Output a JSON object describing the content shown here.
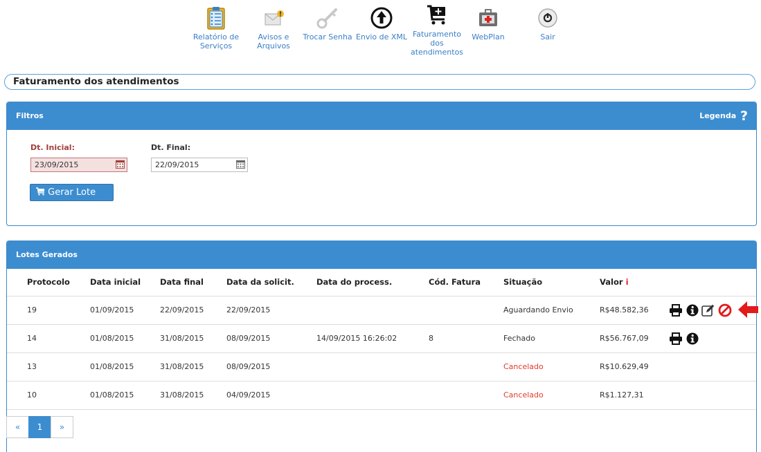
{
  "nav": {
    "items": [
      {
        "id": "relatorio",
        "label": "Relatório de\nServiços",
        "icon": "clipboard-report-icon"
      },
      {
        "id": "avisos",
        "label": "Avisos e\nArquivos",
        "icon": "envelope-warning-icon"
      },
      {
        "id": "senha",
        "label": "Trocar Senha",
        "icon": "key-icon"
      },
      {
        "id": "xml",
        "label": "Envio de XML",
        "icon": "upload-circle-icon"
      },
      {
        "id": "faturamento",
        "label": "Faturamento\ndos\natendimentos",
        "icon": "cart-plus-icon"
      },
      {
        "id": "webplan",
        "label": "WebPlan",
        "icon": "medical-kit-icon"
      },
      {
        "id": "sair",
        "label": "Sair",
        "icon": "power-icon"
      }
    ]
  },
  "page": {
    "title": "Faturamento dos atendimentos"
  },
  "filters": {
    "header": "Filtros",
    "legend_label": "Legenda",
    "legend_icon": "question-icon",
    "start_label": "Dt. Inicial:",
    "start_value": "23/09/2015",
    "end_label": "Dt. Final:",
    "end_value": "22/09/2015",
    "generate_button": "Gerar Lote"
  },
  "lotes": {
    "header": "Lotes Gerados",
    "columns": [
      "Protocolo",
      "Data inicial",
      "Data final",
      "Data da solicit.",
      "Data do process.",
      "Cód. Fatura",
      "Situação",
      "Valor"
    ],
    "rows": [
      {
        "protocolo": "19",
        "data_inicial": "01/09/2015",
        "data_final": "22/09/2015",
        "data_solicit": "22/09/2015",
        "data_process": "",
        "cod_fatura": "",
        "situacao": "Aguardando Envio",
        "valor": "R$48.582,36",
        "actions": [
          "print",
          "info",
          "edit",
          "cancel"
        ]
      },
      {
        "protocolo": "14",
        "data_inicial": "01/08/2015",
        "data_final": "31/08/2015",
        "data_solicit": "08/09/2015",
        "data_process": "14/09/2015 16:26:02",
        "cod_fatura": "8",
        "situacao": "Fechado",
        "valor": "R$56.767,09",
        "actions": [
          "print",
          "info"
        ]
      },
      {
        "protocolo": "13",
        "data_inicial": "01/08/2015",
        "data_final": "31/08/2015",
        "data_solicit": "08/09/2015",
        "data_process": "",
        "cod_fatura": "",
        "situacao": "Cancelado",
        "valor": "R$10.629,49",
        "actions": []
      },
      {
        "protocolo": "10",
        "data_inicial": "01/08/2015",
        "data_final": "31/08/2015",
        "data_solicit": "04/09/2015",
        "data_process": "",
        "cod_fatura": "",
        "situacao": "Cancelado",
        "valor": "R$1.127,31",
        "actions": []
      }
    ]
  },
  "pagination": {
    "prev": "«",
    "current": "1",
    "next": "»"
  },
  "colors": {
    "accent": "#3c8dd0",
    "cancel": "#e23a2e",
    "error_label": "#a0403a"
  }
}
